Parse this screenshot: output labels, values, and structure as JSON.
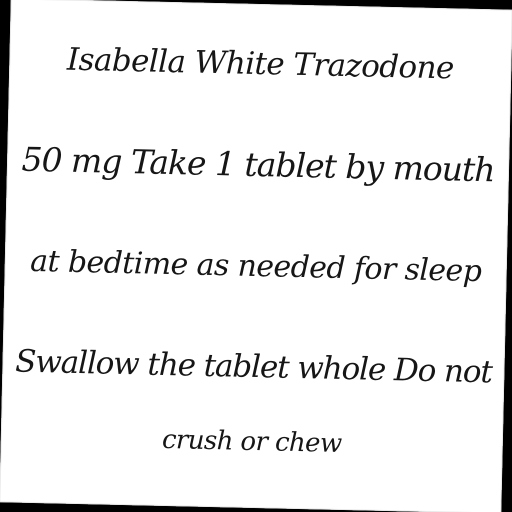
{
  "note": {
    "lines": [
      "Isabella White Trazodone",
      "50 mg Take 1 tablet by mouth",
      "at bedtime as needed for sleep",
      "Swallow the tablet whole Do not",
      "crush or chew"
    ]
  }
}
